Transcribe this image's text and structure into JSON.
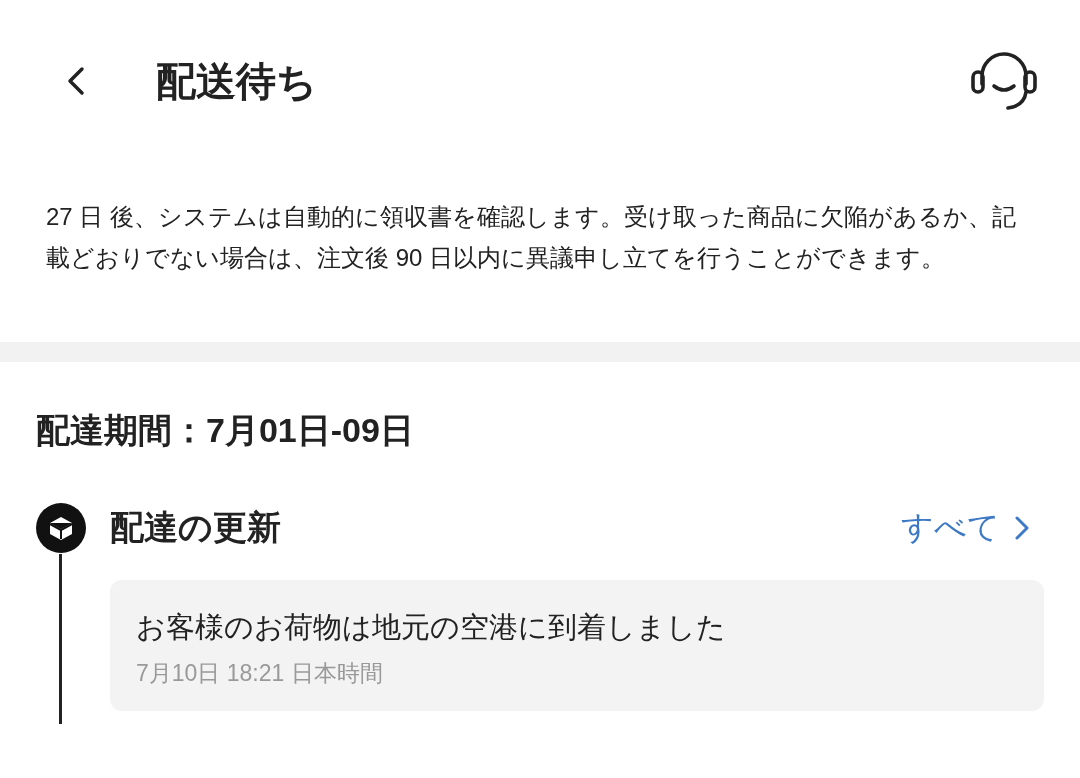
{
  "header": {
    "title": "配送待ち"
  },
  "notice": "27 日 後、システムは自動的に領収書を確認します。受け取った商品に欠陥があるか、記載どおりでない場合は、注文後 90 日以内に異議申し立てを行うことができます。",
  "delivery": {
    "period": "配達期間：7月01日-09日",
    "updates_title": "配達の更新",
    "see_all": "すべて",
    "updates": [
      {
        "message": "お客様のお荷物は地元の空港に到着しました",
        "time": "7月10日 18:21 日本時間"
      }
    ]
  }
}
